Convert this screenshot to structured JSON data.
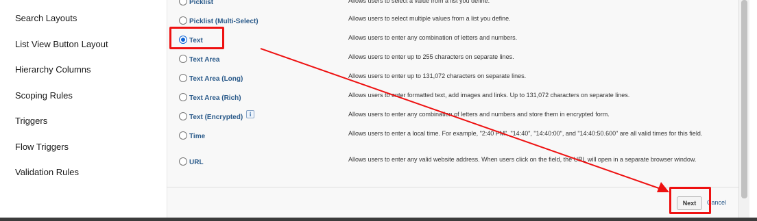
{
  "sidebar": {
    "items": [
      {
        "label": "Search Layouts"
      },
      {
        "label": "List View Button Layout"
      },
      {
        "label": "Hierarchy Columns"
      },
      {
        "label": "Scoping Rules"
      },
      {
        "label": "Triggers"
      },
      {
        "label": "Flow Triggers"
      },
      {
        "label": "Validation Rules"
      }
    ]
  },
  "field_types": [
    {
      "label": "Picklist",
      "description": "Allows users to select a value from a list you define."
    },
    {
      "label": "Picklist (Multi-Select)",
      "description": "Allows users to select multiple values from a list you define."
    },
    {
      "label": "Text",
      "description": "Allows users to enter any combination of letters and numbers.",
      "selected": true
    },
    {
      "label": "Text Area",
      "description": "Allows users to enter up to 255 characters on separate lines."
    },
    {
      "label": "Text Area (Long)",
      "description": "Allows users to enter up to 131,072 characters on separate lines."
    },
    {
      "label": "Text Area (Rich)",
      "description": "Allows users to enter formatted text, add images and links. Up to 131,072 characters on separate lines."
    },
    {
      "label": "Text (Encrypted)",
      "description": "Allows users to enter any combination of letters and numbers and store them in encrypted form.",
      "info_icon": "i"
    },
    {
      "label": "Time",
      "description": "Allows users to enter a local time. For example, \"2:40 PM\", \"14:40\", \"14:40:00\", and \"14:40:50.600\" are all valid times for this field."
    },
    {
      "label": "URL",
      "description": "Allows users to enter any valid website address. When users click on the field, the URL will open in a separate browser window."
    }
  ],
  "footer": {
    "next_label": "Next",
    "cancel_label": "Cancel"
  },
  "colors": {
    "annotation": "#ee1111",
    "link": "#2a5a8a",
    "radio_selected": "#0b63d6"
  }
}
